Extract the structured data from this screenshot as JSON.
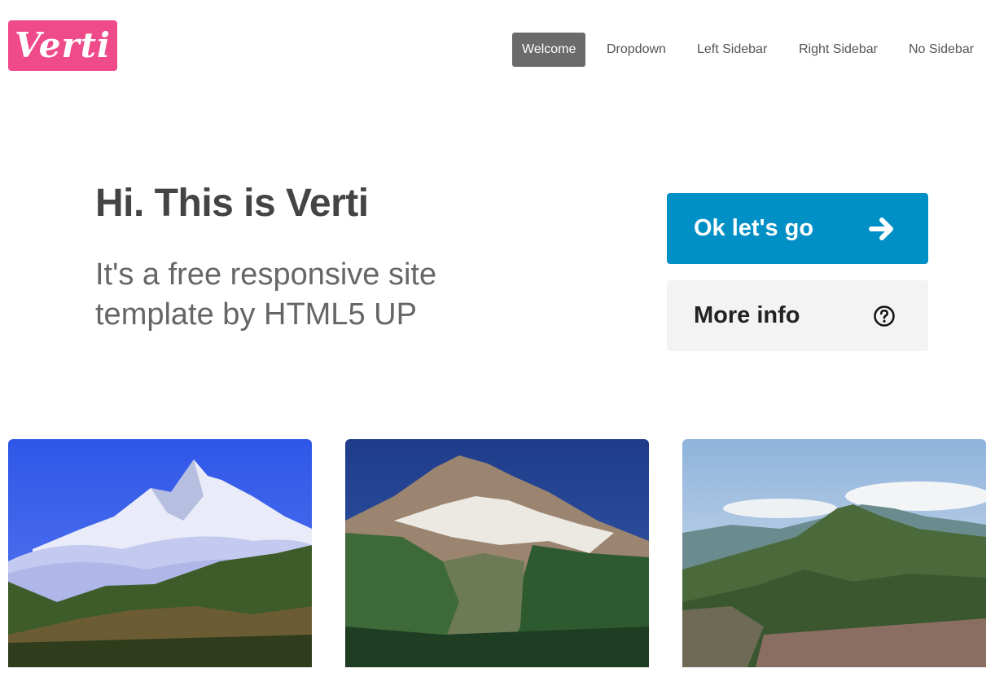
{
  "header": {
    "logo_text": "Verti",
    "nav": [
      {
        "label": "Welcome",
        "active": true
      },
      {
        "label": "Dropdown",
        "active": false
      },
      {
        "label": "Left Sidebar",
        "active": false
      },
      {
        "label": "Right Sidebar",
        "active": false
      },
      {
        "label": "No Sidebar",
        "active": false
      }
    ]
  },
  "hero": {
    "title": "Hi. This is Verti",
    "subtitle_line1": "It's a free responsive site",
    "subtitle_line2": "template by HTML5 UP"
  },
  "actions": {
    "primary_label": "Ok let's go",
    "primary_icon": "arrow-right-icon",
    "secondary_label": "More info",
    "secondary_icon": "question-circle-icon"
  },
  "gallery": [
    {
      "name": "snowy-peak-over-clouds-photo"
    },
    {
      "name": "volcanic-mountain-forest-photo"
    },
    {
      "name": "green-mountain-ridge-photo"
    }
  ],
  "colors": {
    "logo": "#ef4a8a",
    "nav_active": "#6b6b6b",
    "primary_button": "#0090c5",
    "secondary_button": "#f3f3f3"
  }
}
